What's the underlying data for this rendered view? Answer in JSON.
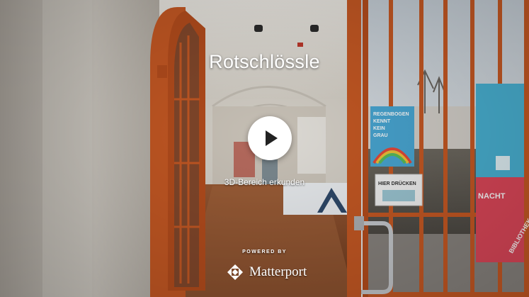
{
  "title": "Rotschlössle",
  "play": {
    "icon": "play-icon"
  },
  "explore_label": "3D-Bereich erkunden",
  "powered_by": "POWERED BY",
  "brand": {
    "name": "Matterport",
    "icon": "matterport-logo-icon"
  },
  "posters": {
    "left_lines": [
      "REGENBOGEN",
      "KENNT",
      "KEIN",
      "GRAU"
    ],
    "sign": "HIER DRÜCKEN",
    "right_lines": [
      "NACHT",
      "BIBLIOTHEK"
    ]
  },
  "colors": {
    "door_frame": "#c95a24",
    "play_bg": "#ffffff",
    "text": "#ffffff"
  }
}
